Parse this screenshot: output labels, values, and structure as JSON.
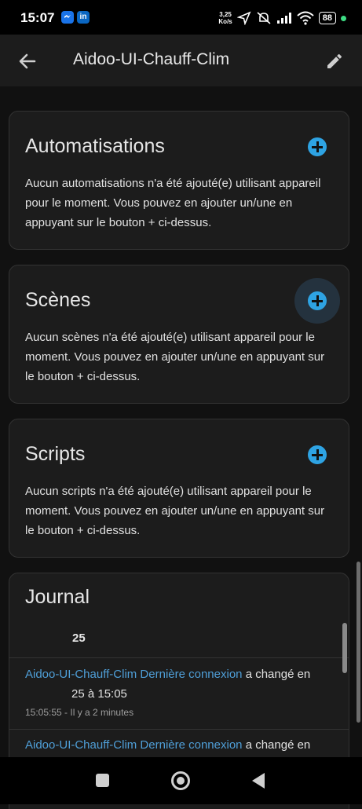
{
  "status_bar": {
    "time": "15:07",
    "speed_value": "3,25",
    "speed_unit": "Ko/s",
    "battery": "88",
    "app_icons": [
      "messenger-icon",
      "linkedin-icon"
    ],
    "linkedin_text": "in"
  },
  "appbar": {
    "title": "Aidoo-UI-Chauff-Clim",
    "back_icon": "arrow-back-icon",
    "edit_icon": "pencil-icon"
  },
  "cards": {
    "automations": {
      "title": "Automatisations",
      "body": "Aucun automatisations n'a été ajouté(e) utilisant appareil pour le moment. Vous pouvez en ajouter un/une en appuyant sur le bouton + ci-dessus."
    },
    "scenes": {
      "title": "Scènes",
      "body": "Aucun scènes n'a été ajouté(e) utilisant appareil pour le moment. Vous pouvez en ajouter un/une en appuyant sur le bouton + ci-dessus."
    },
    "scripts": {
      "title": "Scripts",
      "body": "Aucun scripts n'a été ajouté(e) utilisant appareil pour le moment. Vous pouvez en ajouter un/une en appuyant sur le bouton + ci-dessus."
    }
  },
  "journal": {
    "title": "Journal",
    "date_header": "25",
    "entries": [
      {
        "entity": "Aidoo-UI-Chauff-Clim Dernière connexion",
        "action": "a changé en",
        "value": "25 à 15:05",
        "time": "15:05:55 - Il y a 2 minutes"
      },
      {
        "entity": "Aidoo-UI-Chauff-Clim Dernière connexion",
        "action": "a changé en"
      }
    ]
  },
  "colors": {
    "background": "#111111",
    "card": "#1c1c1c",
    "accent": "#2ea3e3",
    "link": "#4f9fd8"
  }
}
